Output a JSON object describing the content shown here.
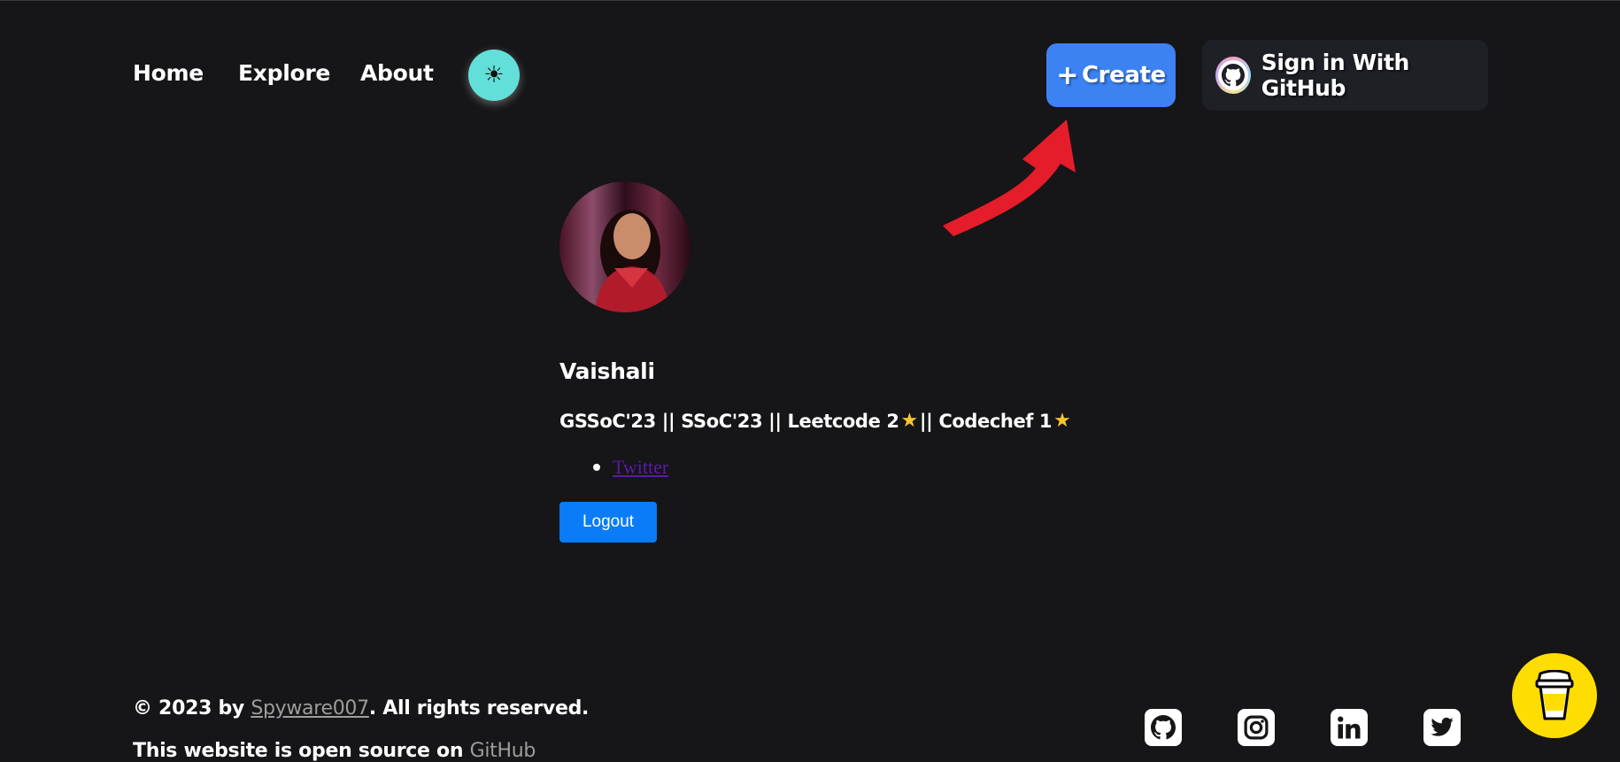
{
  "nav": {
    "home": "Home",
    "explore": "Explore",
    "about": "About",
    "theme_icon": "☀"
  },
  "header": {
    "create_label": "Create",
    "create_icon": "+",
    "signin_label": "Sign in With GitHub"
  },
  "profile": {
    "name": "Vaishali",
    "bio_parts": {
      "part1": "GSSoC'23 || SSoC'23 || Leetcode 2",
      "part2": "|| Codechef 1"
    },
    "links": [
      {
        "label": "Twitter"
      }
    ],
    "logout_label": "Logout"
  },
  "footer": {
    "copy_prefix": "© 2023 by ",
    "author": "Spyware007",
    "copy_suffix": ". All rights reserved.",
    "source_prefix": "This website is open source on ",
    "source_link": "GitHub"
  },
  "social": [
    "github-icon",
    "instagram-icon",
    "linkedin-icon",
    "twitter-icon"
  ],
  "colors": {
    "background": "#161517",
    "create_button": "#3d82f2",
    "theme_toggle": "#62dfd9",
    "logout_button": "#0a7cf7",
    "coffee_button": "#fedd02",
    "annotation_arrow": "#e51c2a"
  }
}
